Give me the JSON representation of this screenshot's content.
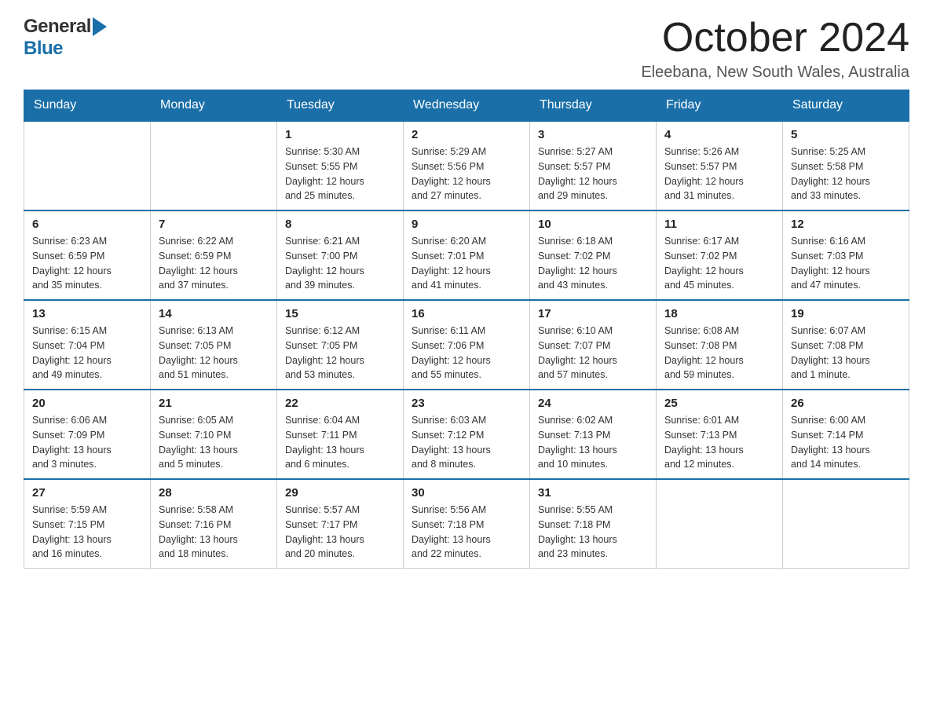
{
  "header": {
    "logo_line1": "General",
    "logo_line2": "Blue",
    "month_title": "October 2024",
    "location": "Eleebana, New South Wales, Australia"
  },
  "weekdays": [
    "Sunday",
    "Monday",
    "Tuesday",
    "Wednesday",
    "Thursday",
    "Friday",
    "Saturday"
  ],
  "weeks": [
    [
      {
        "day": "",
        "info": ""
      },
      {
        "day": "",
        "info": ""
      },
      {
        "day": "1",
        "info": "Sunrise: 5:30 AM\nSunset: 5:55 PM\nDaylight: 12 hours\nand 25 minutes."
      },
      {
        "day": "2",
        "info": "Sunrise: 5:29 AM\nSunset: 5:56 PM\nDaylight: 12 hours\nand 27 minutes."
      },
      {
        "day": "3",
        "info": "Sunrise: 5:27 AM\nSunset: 5:57 PM\nDaylight: 12 hours\nand 29 minutes."
      },
      {
        "day": "4",
        "info": "Sunrise: 5:26 AM\nSunset: 5:57 PM\nDaylight: 12 hours\nand 31 minutes."
      },
      {
        "day": "5",
        "info": "Sunrise: 5:25 AM\nSunset: 5:58 PM\nDaylight: 12 hours\nand 33 minutes."
      }
    ],
    [
      {
        "day": "6",
        "info": "Sunrise: 6:23 AM\nSunset: 6:59 PM\nDaylight: 12 hours\nand 35 minutes."
      },
      {
        "day": "7",
        "info": "Sunrise: 6:22 AM\nSunset: 6:59 PM\nDaylight: 12 hours\nand 37 minutes."
      },
      {
        "day": "8",
        "info": "Sunrise: 6:21 AM\nSunset: 7:00 PM\nDaylight: 12 hours\nand 39 minutes."
      },
      {
        "day": "9",
        "info": "Sunrise: 6:20 AM\nSunset: 7:01 PM\nDaylight: 12 hours\nand 41 minutes."
      },
      {
        "day": "10",
        "info": "Sunrise: 6:18 AM\nSunset: 7:02 PM\nDaylight: 12 hours\nand 43 minutes."
      },
      {
        "day": "11",
        "info": "Sunrise: 6:17 AM\nSunset: 7:02 PM\nDaylight: 12 hours\nand 45 minutes."
      },
      {
        "day": "12",
        "info": "Sunrise: 6:16 AM\nSunset: 7:03 PM\nDaylight: 12 hours\nand 47 minutes."
      }
    ],
    [
      {
        "day": "13",
        "info": "Sunrise: 6:15 AM\nSunset: 7:04 PM\nDaylight: 12 hours\nand 49 minutes."
      },
      {
        "day": "14",
        "info": "Sunrise: 6:13 AM\nSunset: 7:05 PM\nDaylight: 12 hours\nand 51 minutes."
      },
      {
        "day": "15",
        "info": "Sunrise: 6:12 AM\nSunset: 7:05 PM\nDaylight: 12 hours\nand 53 minutes."
      },
      {
        "day": "16",
        "info": "Sunrise: 6:11 AM\nSunset: 7:06 PM\nDaylight: 12 hours\nand 55 minutes."
      },
      {
        "day": "17",
        "info": "Sunrise: 6:10 AM\nSunset: 7:07 PM\nDaylight: 12 hours\nand 57 minutes."
      },
      {
        "day": "18",
        "info": "Sunrise: 6:08 AM\nSunset: 7:08 PM\nDaylight: 12 hours\nand 59 minutes."
      },
      {
        "day": "19",
        "info": "Sunrise: 6:07 AM\nSunset: 7:08 PM\nDaylight: 13 hours\nand 1 minute."
      }
    ],
    [
      {
        "day": "20",
        "info": "Sunrise: 6:06 AM\nSunset: 7:09 PM\nDaylight: 13 hours\nand 3 minutes."
      },
      {
        "day": "21",
        "info": "Sunrise: 6:05 AM\nSunset: 7:10 PM\nDaylight: 13 hours\nand 5 minutes."
      },
      {
        "day": "22",
        "info": "Sunrise: 6:04 AM\nSunset: 7:11 PM\nDaylight: 13 hours\nand 6 minutes."
      },
      {
        "day": "23",
        "info": "Sunrise: 6:03 AM\nSunset: 7:12 PM\nDaylight: 13 hours\nand 8 minutes."
      },
      {
        "day": "24",
        "info": "Sunrise: 6:02 AM\nSunset: 7:13 PM\nDaylight: 13 hours\nand 10 minutes."
      },
      {
        "day": "25",
        "info": "Sunrise: 6:01 AM\nSunset: 7:13 PM\nDaylight: 13 hours\nand 12 minutes."
      },
      {
        "day": "26",
        "info": "Sunrise: 6:00 AM\nSunset: 7:14 PM\nDaylight: 13 hours\nand 14 minutes."
      }
    ],
    [
      {
        "day": "27",
        "info": "Sunrise: 5:59 AM\nSunset: 7:15 PM\nDaylight: 13 hours\nand 16 minutes."
      },
      {
        "day": "28",
        "info": "Sunrise: 5:58 AM\nSunset: 7:16 PM\nDaylight: 13 hours\nand 18 minutes."
      },
      {
        "day": "29",
        "info": "Sunrise: 5:57 AM\nSunset: 7:17 PM\nDaylight: 13 hours\nand 20 minutes."
      },
      {
        "day": "30",
        "info": "Sunrise: 5:56 AM\nSunset: 7:18 PM\nDaylight: 13 hours\nand 22 minutes."
      },
      {
        "day": "31",
        "info": "Sunrise: 5:55 AM\nSunset: 7:18 PM\nDaylight: 13 hours\nand 23 minutes."
      },
      {
        "day": "",
        "info": ""
      },
      {
        "day": "",
        "info": ""
      }
    ]
  ]
}
